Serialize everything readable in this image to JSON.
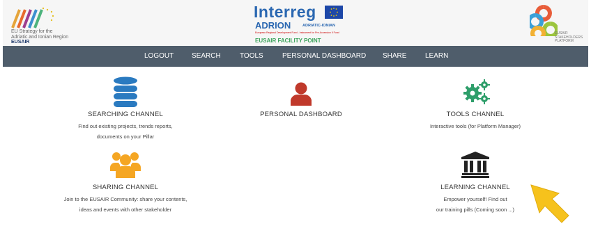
{
  "header": {
    "eusair_logo_text_1": "EU Strategy for the",
    "eusair_logo_text_2": "Adriatic and Ionian Region",
    "eusair_logo_text_3": "EUSAIR",
    "interreg_title": "Interreg",
    "interreg_program": "ADRION",
    "interreg_region": "ADRIATIC-IONIAN",
    "interreg_fund": "European Regional Development Fund - Instrument for Pre-Accession II Fund",
    "facility_point": "EUSAIR FACILITY POINT",
    "platform_name_1": "EUSAIR",
    "platform_name_2": "STAKEHOLDERS",
    "platform_name_3": "PLATFORM"
  },
  "nav": {
    "logout": "LOGOUT",
    "search": "SEARCH",
    "tools": "TOOLS",
    "personal_dashboard": "PERSONAL DASHBOARD",
    "share": "SHARE",
    "learn": "LEARN"
  },
  "channels": {
    "searching": {
      "title": "SEARCHING CHANNEL",
      "desc_1": "Find out existing projects, trends reports,",
      "desc_2": "documents on your Pillar",
      "icon": "database-icon"
    },
    "personal": {
      "title": "PERSONAL DASHBOARD",
      "icon": "user-icon"
    },
    "tools": {
      "title": "TOOLS CHANNEL",
      "desc_1": "Interactive tools (for Platform Manager)",
      "icon": "gears-icon"
    },
    "sharing": {
      "title": "SHARING CHANNEL",
      "desc_1": "Join to the EUSAIR Community: share your contents,",
      "desc_2": "ideas and events with other stakeholder",
      "icon": "users-group-icon"
    },
    "learning": {
      "title": "LEARNING CHANNEL",
      "desc_1": "Empower yourself! Find out",
      "desc_2": "our training pills (Coming soon ...)",
      "icon": "institution-icon"
    }
  },
  "colors": {
    "nav_bg": "#4f5d6b",
    "database_blue": "#2a7ac0",
    "user_red": "#c0392b",
    "gears_green": "#2e9e6a",
    "group_orange": "#f5a623",
    "institution_black": "#222222",
    "arrow_yellow": "#f6c21c"
  }
}
